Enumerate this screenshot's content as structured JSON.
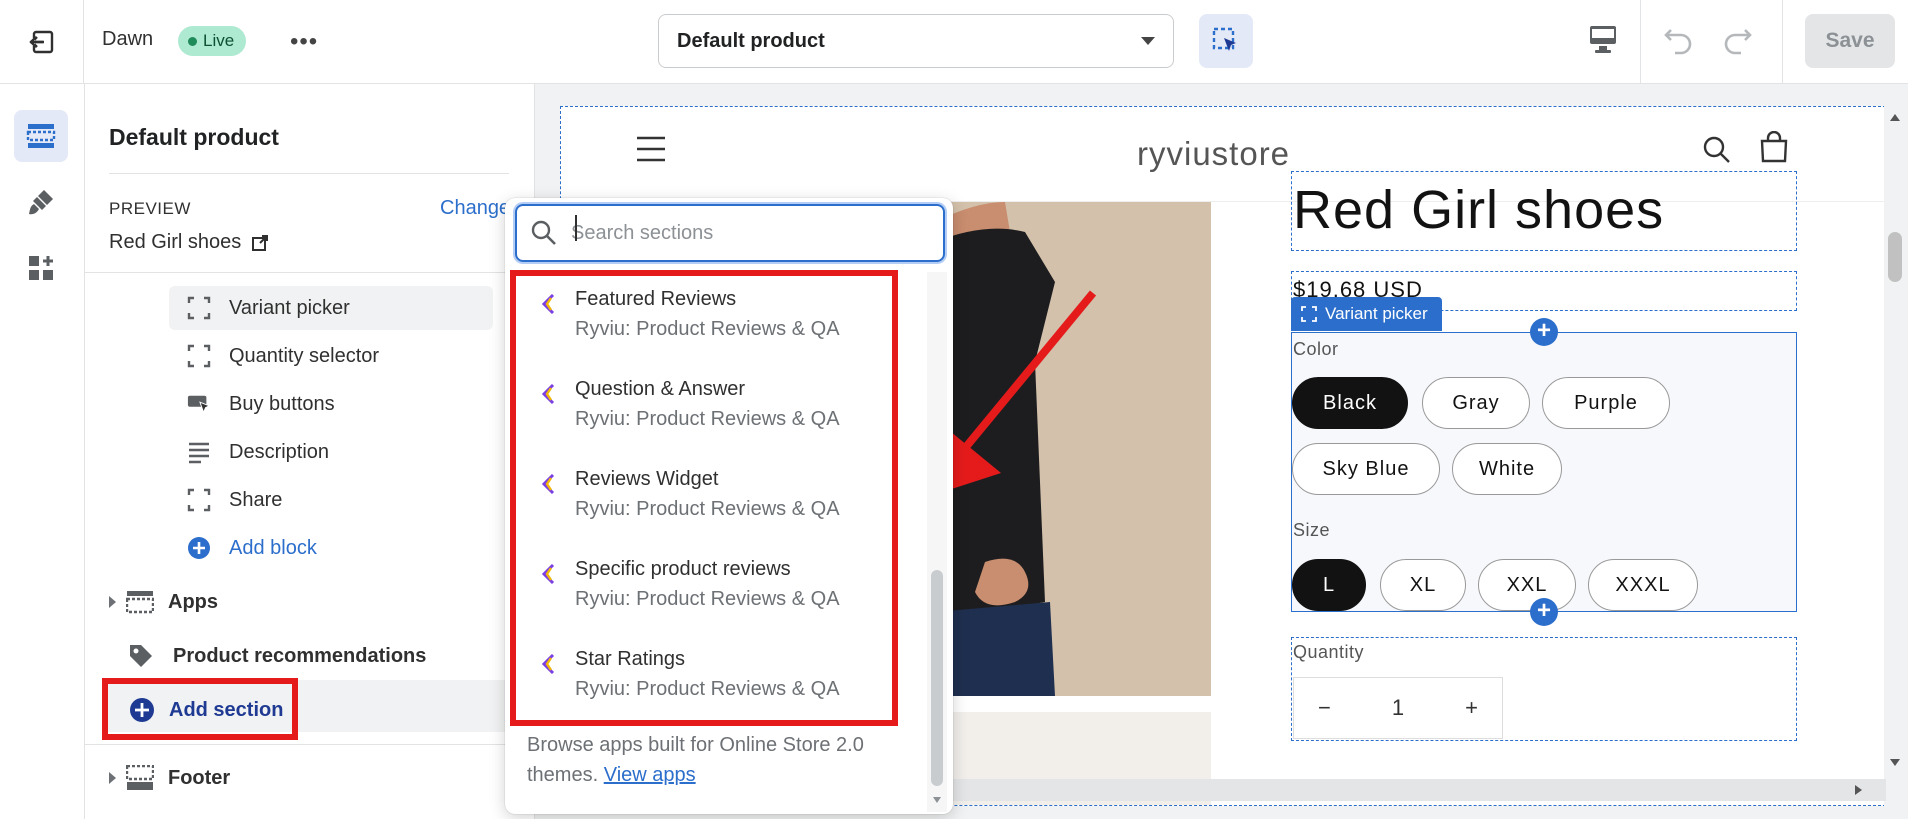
{
  "topbar": {
    "theme_name": "Dawn",
    "status_badge": "Live",
    "more_label": "•••",
    "template_select": "Default product",
    "save_label": "Save"
  },
  "sidebar": {
    "title": "Default product",
    "preview_label": "PREVIEW",
    "change_label": "Change",
    "preview_product": "Red Girl shoes",
    "blocks": [
      {
        "label": "Variant picker",
        "icon": "variant-frame-icon"
      },
      {
        "label": "Quantity selector",
        "icon": "variant-frame-icon"
      },
      {
        "label": "Buy buttons",
        "icon": "buy-buttons-icon"
      },
      {
        "label": "Description",
        "icon": "text-lines-icon"
      },
      {
        "label": "Share",
        "icon": "variant-frame-icon"
      }
    ],
    "add_block_label": "Add block",
    "sections": {
      "apps": "Apps",
      "product_recommendations": "Product recommendations",
      "add_section": "Add section",
      "footer": "Footer"
    }
  },
  "popover": {
    "search_placeholder": "Search sections",
    "items": [
      {
        "name": "Featured Reviews",
        "app": "Ryviu: Product Reviews & QA"
      },
      {
        "name": "Question & Answer",
        "app": "Ryviu: Product Reviews & QA"
      },
      {
        "name": "Reviews Widget",
        "app": "Ryviu: Product Reviews & QA"
      },
      {
        "name": "Specific product reviews",
        "app": "Ryviu: Product Reviews & QA"
      },
      {
        "name": "Star Ratings",
        "app": "Ryviu: Product Reviews & QA"
      }
    ],
    "footer_text": "Browse apps built for Online Store 2.0 themes.",
    "footer_link": "View apps"
  },
  "preview": {
    "store_name": "ryviustore",
    "product_title": "Red Girl shoes",
    "price": "$19.68 USD",
    "variant_picker_tag": "Variant picker",
    "color_label": "Color",
    "colors": [
      "Black",
      "Gray",
      "Purple",
      "Sky Blue",
      "White"
    ],
    "size_label": "Size",
    "sizes": [
      "L",
      "XL",
      "XXL",
      "XXXL"
    ],
    "quantity_label": "Quantity",
    "quantity_minus": "−",
    "quantity_value": "1",
    "quantity_plus": "+"
  },
  "colors": {
    "accent": "#2c6ecb",
    "annotation_red": "#e51b1b",
    "live_badge": "#aee9d1"
  }
}
